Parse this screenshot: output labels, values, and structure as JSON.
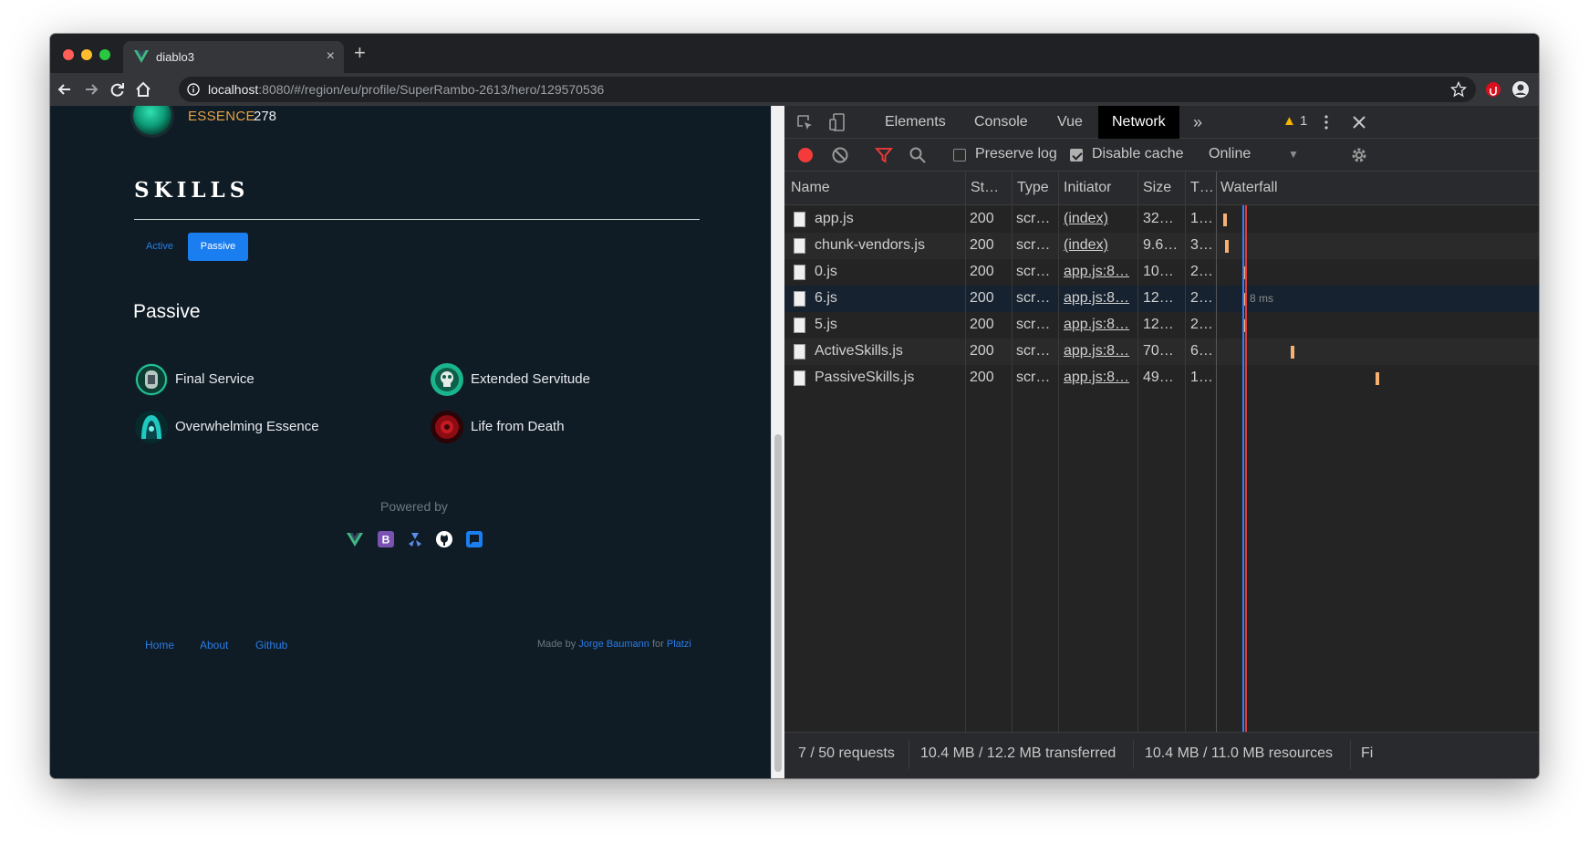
{
  "browser": {
    "tab_title": "diablo3",
    "new_tab": "+",
    "close_tab": "×",
    "url_host": "localhost",
    "url_rest": ":8080/#/region/eu/profile/SuperRambo-2613/hero/129570536"
  },
  "page": {
    "essence_label": "ESSENCE",
    "essence_value": "278",
    "skills_title": "SKILLS",
    "tabs": {
      "active": "Active",
      "passive": "Passive"
    },
    "passive_heading": "Passive",
    "skills": [
      {
        "name": "Final Service"
      },
      {
        "name": "Extended Servitude"
      },
      {
        "name": "Overwhelming Essence"
      },
      {
        "name": "Life from Death"
      }
    ],
    "powered_by": "Powered by",
    "footer": {
      "links": [
        "Home",
        "About",
        "Github"
      ],
      "made_by_prefix": "Made by ",
      "author": "Jorge Baumann",
      "for": " for ",
      "company": "Platzi"
    }
  },
  "devtools": {
    "tabs": [
      "Elements",
      "Console",
      "Vue",
      "Network"
    ],
    "active_tab": "Network",
    "more_tabs": "»",
    "warnings": "1",
    "filterbar": {
      "preserve_log": "Preserve log",
      "disable_cache": "Disable cache",
      "throttle": "Online"
    },
    "columns": [
      "Name",
      "St…",
      "Type",
      "Initiator",
      "Size",
      "T…",
      "Waterfall"
    ],
    "rows": [
      {
        "name": "app.js",
        "status": "200",
        "type": "scr…",
        "initiator": "(index)",
        "size": "32…",
        "time": "1…"
      },
      {
        "name": "chunk-vendors.js",
        "status": "200",
        "type": "scr…",
        "initiator": "(index)",
        "size": "9.6…",
        "time": "3…"
      },
      {
        "name": "0.js",
        "status": "200",
        "type": "scr…",
        "initiator": "app.js:8…",
        "size": "10…",
        "time": "2…"
      },
      {
        "name": "6.js",
        "status": "200",
        "type": "scr…",
        "initiator": "app.js:8…",
        "size": "12…",
        "time": "2…"
      },
      {
        "name": "5.js",
        "status": "200",
        "type": "scr…",
        "initiator": "app.js:8…",
        "size": "12…",
        "time": "2…"
      },
      {
        "name": "ActiveSkills.js",
        "status": "200",
        "type": "scr…",
        "initiator": "app.js:8…",
        "size": "70…",
        "time": "6…"
      },
      {
        "name": "PassiveSkills.js",
        "status": "200",
        "type": "scr…",
        "initiator": "app.js:8…",
        "size": "49…",
        "time": "1…"
      }
    ],
    "waterfall_tip": "8 ms",
    "status": {
      "requests": "7 / 50 requests",
      "transferred": "10.4 MB / 12.2 MB transferred",
      "resources": "10.4 MB / 11.0 MB resources",
      "finish": "Fi"
    },
    "colors": {
      "dom_line": "#3b7bf5",
      "load_line": "#e03b3b",
      "bar": "#f6b072"
    }
  }
}
